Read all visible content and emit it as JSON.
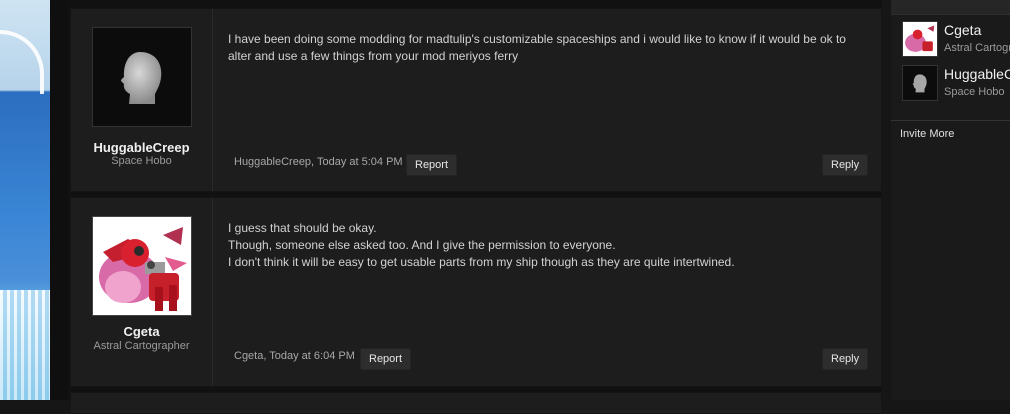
{
  "posts": [
    {
      "username": "HuggableCreep",
      "user_title": "Space Hobo",
      "avatar": "silhouette-head-icon",
      "message_lines": [
        "I have been doing some modding for madtulip's customizable spaceships and i would like to know if it would be ok to alter and use a few things from your mod meriyos ferry"
      ],
      "meta": "HuggableCreep, Today at 5:04 PM",
      "report_label": "Report",
      "reply_label": "Reply"
    },
    {
      "username": "Cgeta",
      "user_title": "Astral Cartographer",
      "avatar": "red-robot-pony-avatar",
      "message_lines": [
        "I guess that should be okay.",
        "Though, someone else asked too. And I give the permission to everyone.",
        "I don't think it will be easy to get usable parts from my ship though as they are quite intertwined."
      ],
      "meta": "Cgeta, Today at 6:04 PM",
      "report_label": "Report",
      "reply_label": "Reply"
    }
  ],
  "sidebar": {
    "members": [
      {
        "name": "Cgeta",
        "title": "Astral Cartographer",
        "avatar": "red-robot-pony-avatar"
      },
      {
        "name": "HuggableCreep",
        "title": "Space Hobo",
        "avatar": "silhouette-head-icon"
      }
    ],
    "invite_label": "Invite More"
  }
}
